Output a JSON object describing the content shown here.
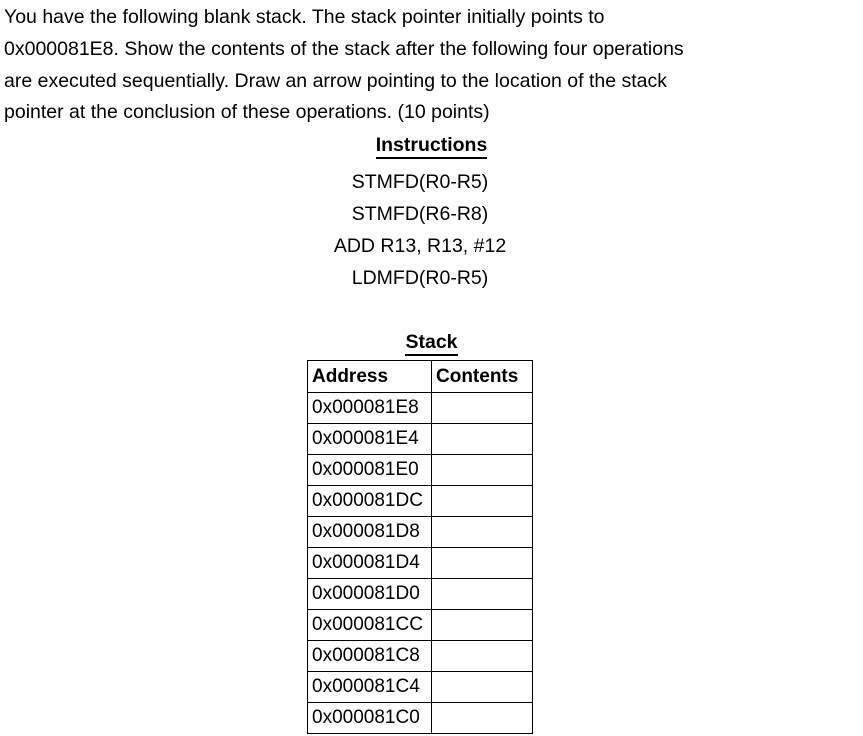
{
  "prompt": {
    "lines": [
      "You have the following blank stack.  The stack pointer initially points to",
      "0x000081E8.  Show the contents of the stack after the following four operations",
      "are executed sequentially.  Draw an arrow pointing to the location of the stack",
      "pointer at the conclusion of these operations. (10 points)"
    ]
  },
  "instructions": {
    "heading": "Instructions",
    "lines": [
      "STMFD(R0-R5)",
      "STMFD(R6-R8)",
      "ADD R13, R13, #12",
      "LDMFD(R0-R5)"
    ]
  },
  "stack": {
    "heading": "Stack",
    "columns": [
      "Address",
      "Contents"
    ],
    "rows": [
      {
        "address": "0x000081E8",
        "contents": ""
      },
      {
        "address": "0x000081E4",
        "contents": ""
      },
      {
        "address": "0x000081E0",
        "contents": ""
      },
      {
        "address": "0x000081DC",
        "contents": ""
      },
      {
        "address": "0x000081D8",
        "contents": ""
      },
      {
        "address": "0x000081D4",
        "contents": ""
      },
      {
        "address": "0x000081D0",
        "contents": ""
      },
      {
        "address": "0x000081CC",
        "contents": ""
      },
      {
        "address": "0x000081C8",
        "contents": ""
      },
      {
        "address": "0x000081C4",
        "contents": ""
      },
      {
        "address": "0x000081C0",
        "contents": ""
      }
    ]
  },
  "colors": {
    "background": "#ffffff",
    "text": "#000000",
    "border": "#000000"
  }
}
